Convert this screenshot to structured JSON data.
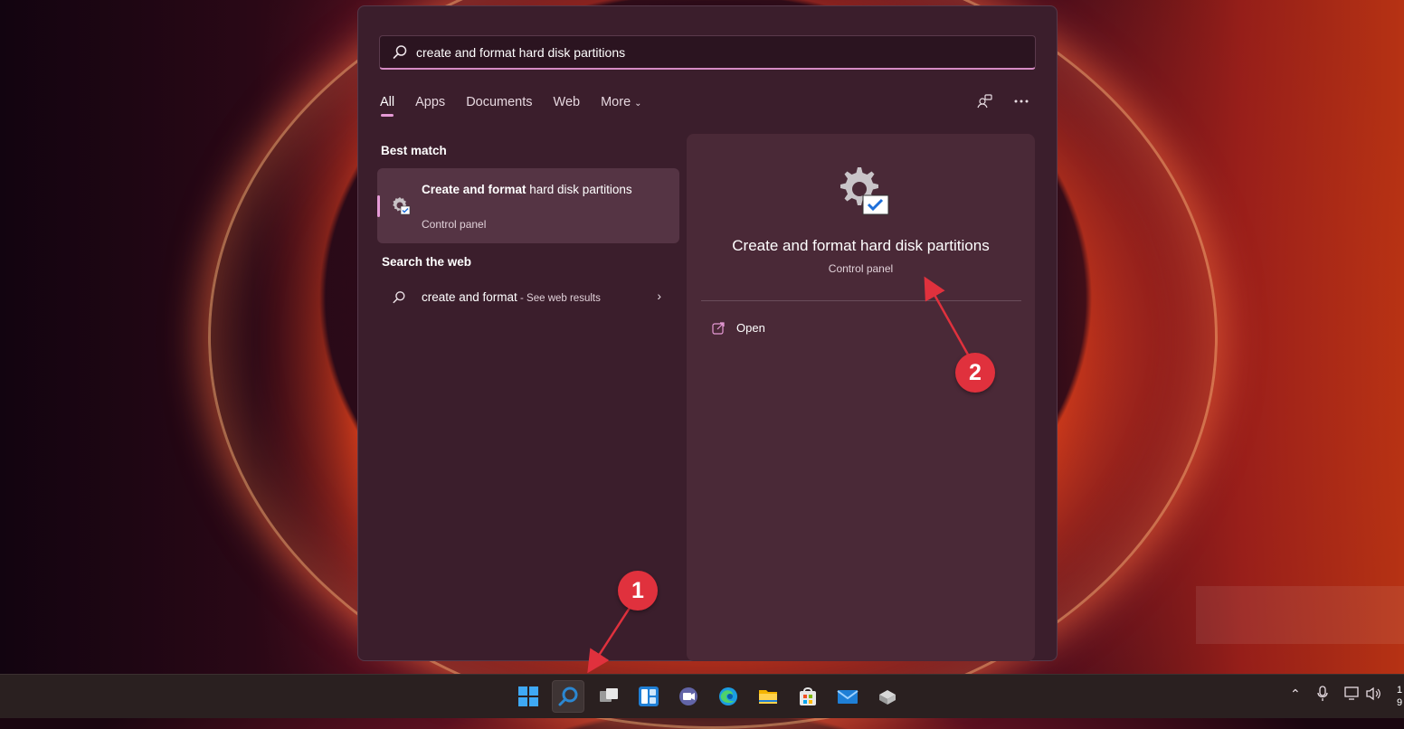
{
  "search": {
    "query": "create and format hard disk partitions",
    "icon": "search-icon"
  },
  "tabs": [
    {
      "label": "All",
      "active": true
    },
    {
      "label": "Apps"
    },
    {
      "label": "Documents"
    },
    {
      "label": "Web"
    },
    {
      "label": "More",
      "dropdown": true
    }
  ],
  "header_icons": [
    "account-search-icon",
    "more-options-icon"
  ],
  "best_match": {
    "section_title": "Best match",
    "title_bold": "Create and format",
    "title_rest": " hard disk partitions",
    "subtitle": "Control panel",
    "icon": "gear-check-icon"
  },
  "web": {
    "section_title": "Search the web",
    "query": "create and format",
    "suffix": " - See web results"
  },
  "preview": {
    "title": "Create and format hard disk partitions",
    "subtitle": "Control panel",
    "actions": [
      {
        "label": "Open",
        "icon": "open-external-icon"
      }
    ]
  },
  "taskbar": {
    "icons": [
      "start-icon",
      "search-icon",
      "task-view-icon",
      "widgets-icon",
      "teams-chat-icon",
      "edge-icon",
      "file-explorer-icon",
      "store-icon",
      "mail-icon",
      "app-icon"
    ],
    "tray": [
      "chevron-up-icon",
      "microphone-icon",
      "network-icon",
      "volume-icon"
    ],
    "clock_partial": "1\n9"
  },
  "annotations": {
    "badge1": "1",
    "badge2": "2",
    "color": "#e0313d"
  },
  "colors": {
    "accent": "#e69ad6",
    "panel": "#3b1e2c",
    "preview": "#4a2937"
  }
}
